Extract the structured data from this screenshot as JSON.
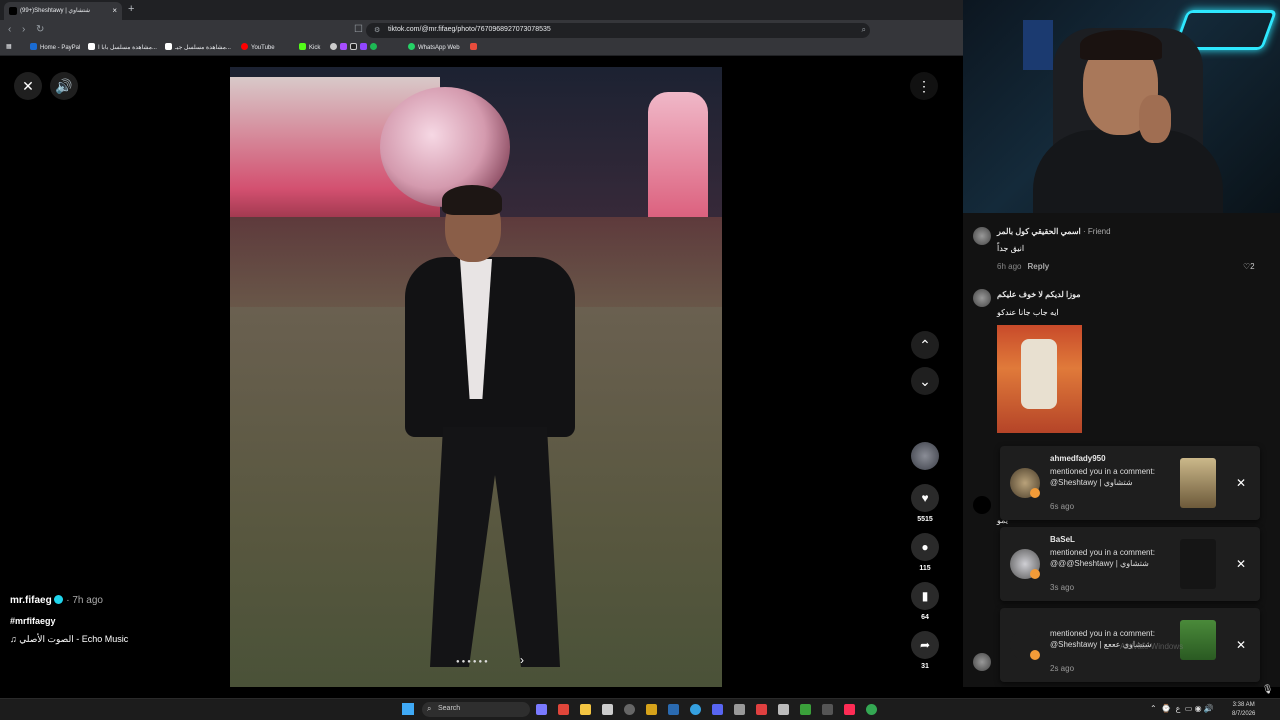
{
  "browser": {
    "tab_title": "(99+)Sheshtawy | شتشاوي",
    "url": "tiktok.com/@mr.fifaeg/photo/7670968927073078535",
    "bookmarks": [
      "Home - PayPal",
      "مشاهدة مسلسل بابا ا...",
      "مشاهدة مسلسل جيـ...",
      "YouTube",
      "Kick",
      "WhatsApp Web"
    ]
  },
  "post": {
    "author": "mr.fifaeg",
    "time_ago": "· 7h ago",
    "hashtag": "#mrfifaegy",
    "music": "الصوت الأصلي - Echo Music",
    "likes": "5515",
    "comments": "115",
    "saves": "64",
    "shares": "31"
  },
  "comments": [
    {
      "name": "اسمي الحقيقي كول بالمر",
      "friend": "· Friend",
      "text": "انيق جداً",
      "time": "6h ago",
      "reply": "Reply",
      "likes": "2"
    },
    {
      "name": "موزا لديكم لا خوف عليكم",
      "text": "ايه جاب جانا عندكو"
    }
  ],
  "partial_text": "يمو",
  "notifications": [
    {
      "user": "ahmedfady950",
      "body": "mentioned you in a comment: @Sheshtawy | شتشاوي",
      "time": "6s ago"
    },
    {
      "user": "BaSeL",
      "body": "mentioned you in a comment: @@@Sheshtawy | شتشاوي",
      "time": "3s ago"
    },
    {
      "user": "",
      "body": "mentioned you in a comment: @Sheshtawy | شتشاوي عععع",
      "time": "2s ago"
    }
  ],
  "watermark": "Activate Windows",
  "taskbar": {
    "search": "Search",
    "time": "3:38 AM",
    "date": "8/7/2026",
    "lang": "ع"
  }
}
